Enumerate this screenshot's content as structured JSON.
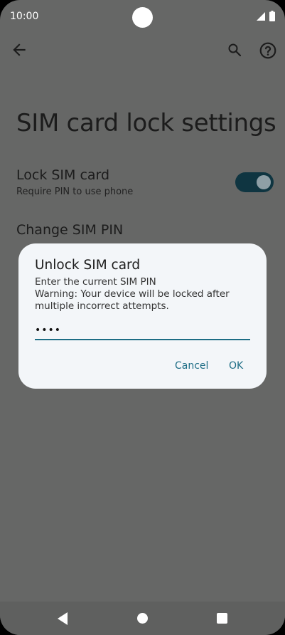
{
  "status_bar": {
    "time": "10:00"
  },
  "app_bar": {
    "back_icon": "arrow-back-icon",
    "search_icon": "search-icon",
    "help_icon": "help-circle-icon"
  },
  "page": {
    "title": "SIM card lock settings",
    "lock_sim": {
      "title": "Lock SIM card",
      "summary": "Require PIN to use phone",
      "enabled": true
    },
    "change_pin": {
      "title": "Change SIM PIN"
    }
  },
  "dialog": {
    "title": "Unlock SIM card",
    "message_line1": "Enter the current SIM PIN",
    "message_line2": "Warning: Your device will be locked after",
    "message_line3": "multiple incorrect attempts.",
    "pin_value": "••••",
    "cancel_label": "Cancel",
    "ok_label": "OK"
  },
  "colors": {
    "accent": "#1d6d85",
    "toggle_track": "#0f3541",
    "scrim": "#666766",
    "dialog_bg": "#f3f6f9"
  }
}
